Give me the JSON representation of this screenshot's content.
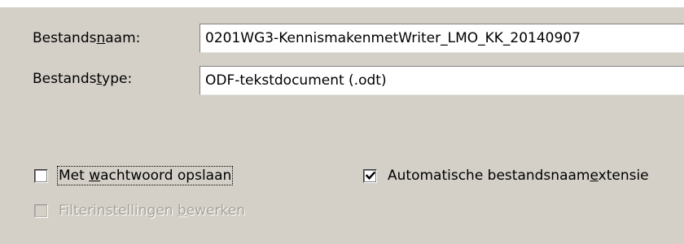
{
  "form": {
    "filename": {
      "label_pre": "Bestands",
      "label_key": "n",
      "label_post": "aam:",
      "value": "0201WG3-KennismakenmetWriter_LMO_KK_20140907"
    },
    "filetype": {
      "label_pre": "Bestands",
      "label_key": "t",
      "label_post": "ype:",
      "value": "ODF-tekstdocument (.odt)"
    }
  },
  "options": {
    "password": {
      "label_pre": "Met ",
      "label_key": "w",
      "label_post": "achtwoord opslaan",
      "checked": false
    },
    "auto_extension": {
      "label_pre": "Automatische bestandsnaam",
      "label_key": "e",
      "label_post": "xtensie",
      "checked": true
    },
    "filter_settings": {
      "label_pre": "Filterinstellingen ",
      "label_key": "b",
      "label_post": "ewerken",
      "checked": false,
      "disabled": true
    }
  }
}
